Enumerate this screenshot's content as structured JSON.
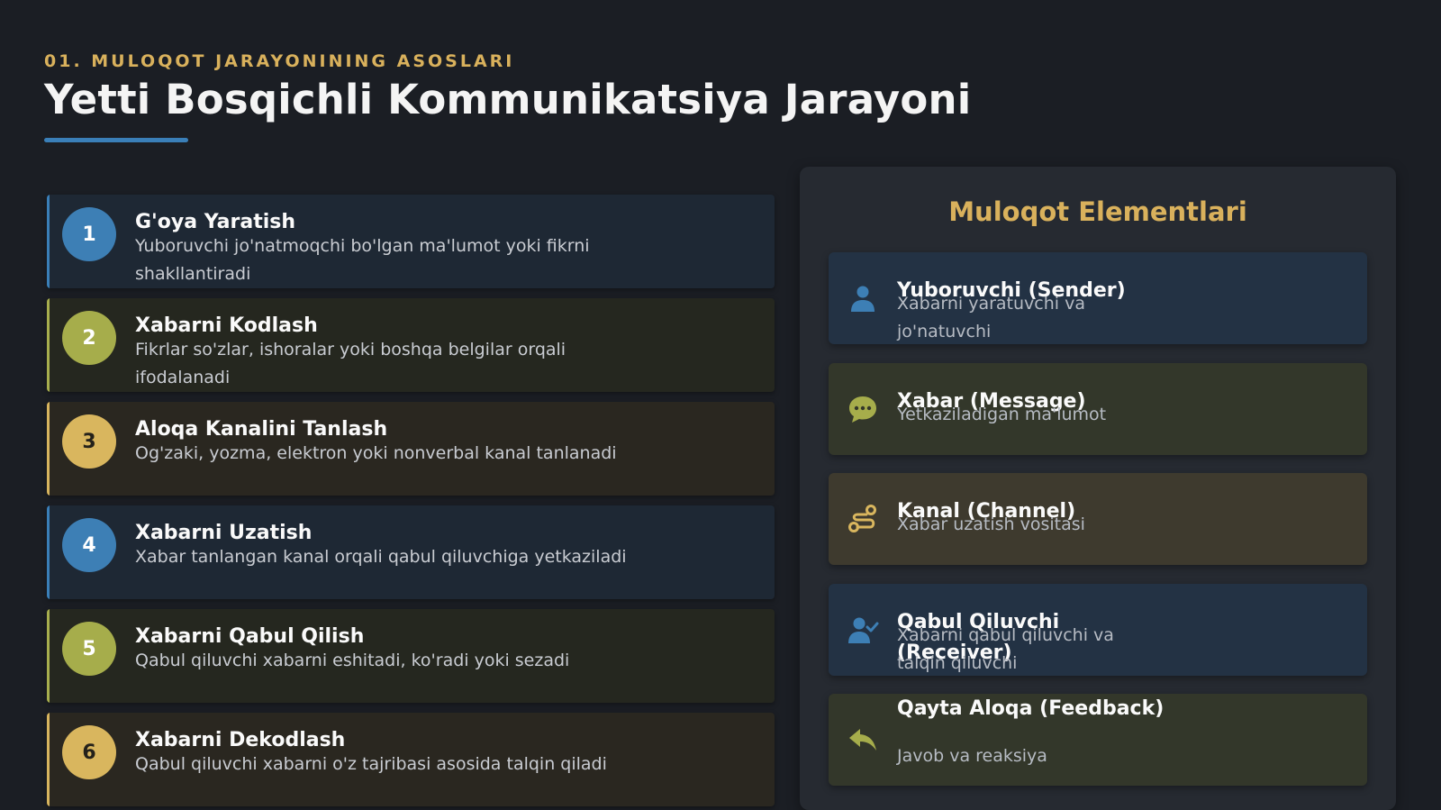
{
  "header": {
    "eyebrow": "01. MULOQOT JARAYONINING ASOSLARI",
    "title": "Yetti Bosqichli Kommunikatsiya Jarayoni"
  },
  "steps": [
    {
      "number": "1",
      "title": "G'oya Yaratish",
      "description": "Yuboruvchi jo'natmoqchi bo'lgan ma'lumot yoki fikrni shakllantiradi",
      "color": "#3d7fb5"
    },
    {
      "number": "2",
      "title": "Xabarni Kodlash",
      "description": "Fikrlar so'zlar, ishoralar yoki boshqa belgilar orqali ifodalanadi",
      "color": "#a6ad4b"
    },
    {
      "number": "3",
      "title": "Aloqa Kanalini Tanlash",
      "description": "Og'zaki, yozma, elektron yoki nonverbal kanal tanlanadi",
      "color": "#d9b65e"
    },
    {
      "number": "4",
      "title": "Xabarni Uzatish",
      "description": "Xabar tanlangan kanal orqali qabul qiluvchiga yetkaziladi",
      "color": "#3d7fb5"
    },
    {
      "number": "5",
      "title": "Xabarni Qabul Qilish",
      "description": "Qabul qiluvchi xabarni eshitadi, ko'radi yoki sezadi",
      "color": "#a6ad4b"
    },
    {
      "number": "6",
      "title": "Xabarni Dekodlash",
      "description": "Qabul qiluvchi xabarni o'z tajribasi asosida talqin qiladi",
      "color": "#d9b65e"
    }
  ],
  "elements_panel": {
    "title": "Muloqot Elementlari",
    "items": [
      {
        "title": "Yuboruvchi (Sender)",
        "description": "Xabarni yaratuvchi va jo'natuvchi",
        "icon": "user-icon",
        "color": "#3d7fb5"
      },
      {
        "title": "Xabar (Message)",
        "description": "Yetkaziladigan ma'lumot",
        "icon": "chat-bubble-icon",
        "color": "#a6ad4b"
      },
      {
        "title": "Kanal (Channel)",
        "description": "Xabar uzatish vositasi",
        "icon": "route-icon",
        "color": "#d9b65e"
      },
      {
        "title": "Qabul Qiluvchi (Receiver)",
        "description": "Xabarni qabul qiluvchi va talqin qiluvchi",
        "icon": "user-check-icon",
        "color": "#3d7fb5"
      },
      {
        "title": "Qayta Aloqa (Feedback)",
        "description": "Javob va reaksiya",
        "icon": "reply-icon",
        "color": "#a6ad4b"
      }
    ]
  }
}
